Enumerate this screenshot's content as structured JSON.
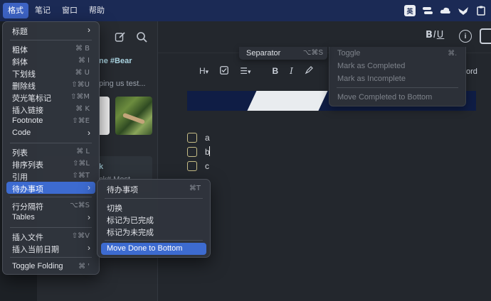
{
  "menubar": {
    "items": [
      "格式",
      "笔记",
      "窗口",
      "帮助"
    ],
    "tray": [
      "input-method-icon",
      "toggle-icon",
      "cloud-icon",
      "bird-icon",
      "clipboard-icon"
    ],
    "tray_ime_label": "英"
  },
  "toolbar": {
    "bold": "B",
    "italic": "I",
    "underline": "U",
    "info": "i"
  },
  "note_list": {
    "tag": "ne #Bear",
    "snippet": "ping us test...",
    "selected_title": "k",
    "selected_snippet": "ck# Most"
  },
  "format_bar": {
    "heading": "H",
    "bold": "B",
    "italic": "I",
    "trailing": "ord"
  },
  "separator_menu": {
    "label": "Separator",
    "shortcut": "⌥⌘S"
  },
  "right_menu": {
    "items": [
      "Toggle",
      "Mark as Completed",
      "Mark as Incomplete",
      "Move Completed to Bottom"
    ],
    "toggle_shortcut": "⌘."
  },
  "tasks": [
    "a",
    "b",
    "c"
  ],
  "format_menu": {
    "items": [
      {
        "label": "标题",
        "shortcut": "",
        "submenu": true
      },
      {
        "label": "粗体",
        "shortcut": "⌘ B",
        "submenu": false
      },
      {
        "label": "斜体",
        "shortcut": "⌘ I",
        "submenu": false
      },
      {
        "label": "下划线",
        "shortcut": "⌘ U",
        "submenu": false
      },
      {
        "label": "删除线",
        "shortcut": "⇧⌘U",
        "submenu": false
      },
      {
        "label": "荧光笔标记",
        "shortcut": "⇧⌘M",
        "submenu": false
      },
      {
        "label": "插入链接",
        "shortcut": "⌘ K",
        "submenu": false
      },
      {
        "label": "Footnote",
        "shortcut": "⇧⌘E",
        "submenu": false
      },
      {
        "label": "Code",
        "shortcut": "",
        "submenu": true
      },
      {
        "label": "列表",
        "shortcut": "⌘ L",
        "submenu": false
      },
      {
        "label": "排序列表",
        "shortcut": "⇧⌘L",
        "submenu": false
      },
      {
        "label": "引用",
        "shortcut": "⇧⌘T",
        "submenu": false
      },
      {
        "label": "待办事项",
        "shortcut": "",
        "submenu": true
      },
      {
        "label": "行分隔符",
        "shortcut": "⌥⌘S",
        "submenu": false
      },
      {
        "label": "Tables",
        "shortcut": "",
        "submenu": true
      },
      {
        "label": "插入文件",
        "shortcut": "⇧⌘V",
        "submenu": false
      },
      {
        "label": "插入当前日期",
        "shortcut": "",
        "submenu": true
      },
      {
        "label": "Toggle Folding",
        "shortcut": "⌘ '",
        "submenu": false
      }
    ]
  },
  "todo_submenu": {
    "items": [
      {
        "label": "待办事项",
        "shortcut": "⌘T"
      },
      {
        "label": "切换",
        "shortcut": ""
      },
      {
        "label": "标记为已完成",
        "shortcut": ""
      },
      {
        "label": "标记为未完成",
        "shortcut": ""
      },
      {
        "label": "Move Done to Bottom",
        "shortcut": ""
      }
    ]
  },
  "colors": {
    "menubar": "#1b2a55",
    "highlight": "#3d6bd0",
    "checkbox": "#c6bd86"
  }
}
